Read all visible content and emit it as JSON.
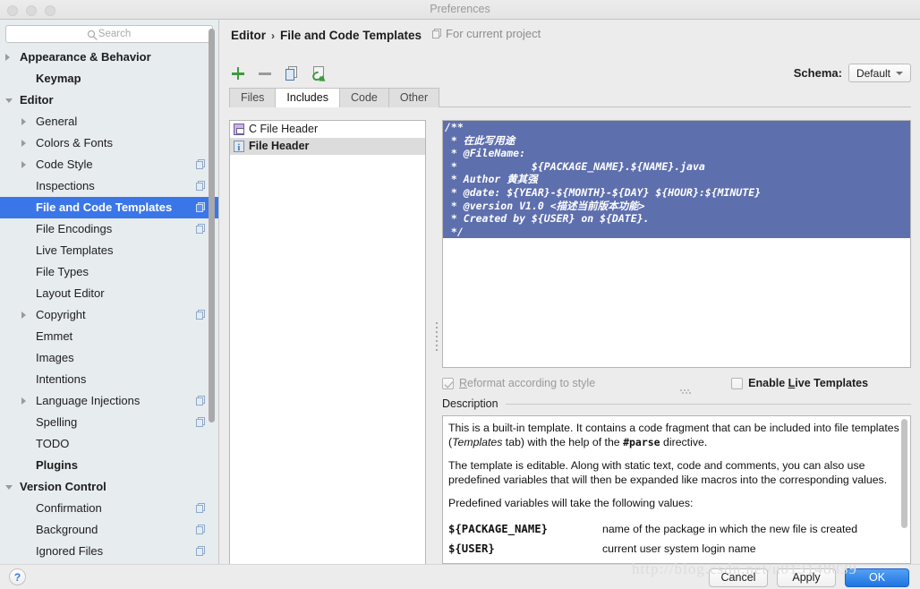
{
  "window": {
    "title": "Preferences",
    "traffic_lights": [
      "close-button",
      "minimize-button",
      "maximize-button"
    ]
  },
  "sidebar": {
    "search": {
      "placeholder": "Search",
      "value": "",
      "icon": "search-icon"
    },
    "items": [
      {
        "label": "Appearance & Behavior",
        "indent": 1,
        "bold": true,
        "arrow": "right",
        "badge": false,
        "selected": false
      },
      {
        "label": "Keymap",
        "indent": 2,
        "bold": true,
        "arrow": "none",
        "badge": false,
        "selected": false
      },
      {
        "label": "Editor",
        "indent": 1,
        "bold": true,
        "arrow": "down",
        "badge": false,
        "selected": false
      },
      {
        "label": "General",
        "indent": 2,
        "bold": false,
        "arrow": "right",
        "badge": false,
        "selected": false
      },
      {
        "label": "Colors & Fonts",
        "indent": 2,
        "bold": false,
        "arrow": "right",
        "badge": false,
        "selected": false
      },
      {
        "label": "Code Style",
        "indent": 2,
        "bold": false,
        "arrow": "right",
        "badge": true,
        "selected": false
      },
      {
        "label": "Inspections",
        "indent": 2,
        "bold": false,
        "arrow": "none",
        "badge": true,
        "selected": false
      },
      {
        "label": "File and Code Templates",
        "indent": 2,
        "bold": true,
        "arrow": "none",
        "badge": true,
        "selected": true
      },
      {
        "label": "File Encodings",
        "indent": 2,
        "bold": false,
        "arrow": "none",
        "badge": true,
        "selected": false
      },
      {
        "label": "Live Templates",
        "indent": 2,
        "bold": false,
        "arrow": "none",
        "badge": false,
        "selected": false
      },
      {
        "label": "File Types",
        "indent": 2,
        "bold": false,
        "arrow": "none",
        "badge": false,
        "selected": false
      },
      {
        "label": "Layout Editor",
        "indent": 2,
        "bold": false,
        "arrow": "none",
        "badge": false,
        "selected": false
      },
      {
        "label": "Copyright",
        "indent": 2,
        "bold": false,
        "arrow": "right",
        "badge": true,
        "selected": false
      },
      {
        "label": "Emmet",
        "indent": 2,
        "bold": false,
        "arrow": "none",
        "badge": false,
        "selected": false
      },
      {
        "label": "Images",
        "indent": 2,
        "bold": false,
        "arrow": "none",
        "badge": false,
        "selected": false
      },
      {
        "label": "Intentions",
        "indent": 2,
        "bold": false,
        "arrow": "none",
        "badge": false,
        "selected": false
      },
      {
        "label": "Language Injections",
        "indent": 2,
        "bold": false,
        "arrow": "right",
        "badge": true,
        "selected": false
      },
      {
        "label": "Spelling",
        "indent": 2,
        "bold": false,
        "arrow": "none",
        "badge": true,
        "selected": false
      },
      {
        "label": "TODO",
        "indent": 2,
        "bold": false,
        "arrow": "none",
        "badge": false,
        "selected": false
      },
      {
        "label": "Plugins",
        "indent": 2,
        "bold": true,
        "arrow": "none",
        "badge": false,
        "selected": false
      },
      {
        "label": "Version Control",
        "indent": 1,
        "bold": true,
        "arrow": "down",
        "badge": false,
        "selected": false
      },
      {
        "label": "Confirmation",
        "indent": 2,
        "bold": false,
        "arrow": "none",
        "badge": true,
        "selected": false
      },
      {
        "label": "Background",
        "indent": 2,
        "bold": false,
        "arrow": "none",
        "badge": true,
        "selected": false
      },
      {
        "label": "Ignored Files",
        "indent": 2,
        "bold": false,
        "arrow": "none",
        "badge": true,
        "selected": false
      }
    ]
  },
  "header": {
    "breadcrumb_parent": "Editor",
    "breadcrumb_sep": "›",
    "breadcrumb_current": "File and Code Templates",
    "scope_label": "For current project",
    "schema_label": "Schema:",
    "schema_value": "Default"
  },
  "toolbar": {
    "buttons": [
      {
        "name": "add-template-button",
        "icon": "plus-icon"
      },
      {
        "name": "remove-template-button",
        "icon": "minus-icon"
      },
      {
        "name": "copy-template-button",
        "icon": "copy-icon"
      },
      {
        "name": "reset-template-button",
        "icon": "reset-icon"
      }
    ]
  },
  "tabs": [
    {
      "label": "Files",
      "active": false
    },
    {
      "label": "Includes",
      "active": true
    },
    {
      "label": "Code",
      "active": false
    },
    {
      "label": "Other",
      "active": false
    }
  ],
  "template_list": [
    {
      "label": "C File Header",
      "icon": "c-file-icon",
      "selected": false
    },
    {
      "label": "File Header",
      "icon": "info-file-icon",
      "selected": true
    }
  ],
  "editor": {
    "lines": [
      "/**",
      " * 在此写用途",
      " * @FileName:",
      " *            ${PACKAGE_NAME}.${NAME}.java",
      " * Author 黄其强",
      " * @date: ${YEAR}-${MONTH}-${DAY} ${HOUR}:${MINUTE}",
      " * @version V1.0 <描述当前版本功能>",
      " * Created by ${USER} on ${DATE}.",
      " */"
    ],
    "selection_color": "#5e6fae"
  },
  "options": {
    "reformat": {
      "label": "Reformat according to style",
      "checked": true,
      "enabled": false
    },
    "live_templates": {
      "label": "Enable Live Templates",
      "checked": false,
      "enabled": true
    }
  },
  "description": {
    "title": "Description",
    "paragraphs": [
      "This is a built-in template. It contains a code fragment that can be included into file templates (Templates tab) with the help of the #parse directive.",
      "The template is editable. Along with static text, code and comments, you can also use predefined variables that will then be expanded like macros into the corresponding values.",
      "Predefined variables will take the following values:"
    ],
    "p1_a": "This is a built-in template. It contains a code fragment that can be included into file templates (",
    "p1_em": "Templates",
    "p1_b": " tab) with the help of the ",
    "p1_strong": "#parse",
    "p1_c": " directive.",
    "p2": "The template is editable. Along with static text, code and comments, you can also use predefined variables that will then be expanded like macros into the corresponding values.",
    "p3": "Predefined variables will take the following values:",
    "variables": [
      {
        "name": "${PACKAGE_NAME}",
        "meaning": "name of the package in which the new file is created"
      },
      {
        "name": "${USER}",
        "meaning": "current user system login name"
      }
    ]
  },
  "footer": {
    "help_label": "?",
    "cancel_label": "Cancel",
    "apply_label": "Apply",
    "ok_label": "OK"
  },
  "watermark": "http://blog.csdn.net/u013148839"
}
